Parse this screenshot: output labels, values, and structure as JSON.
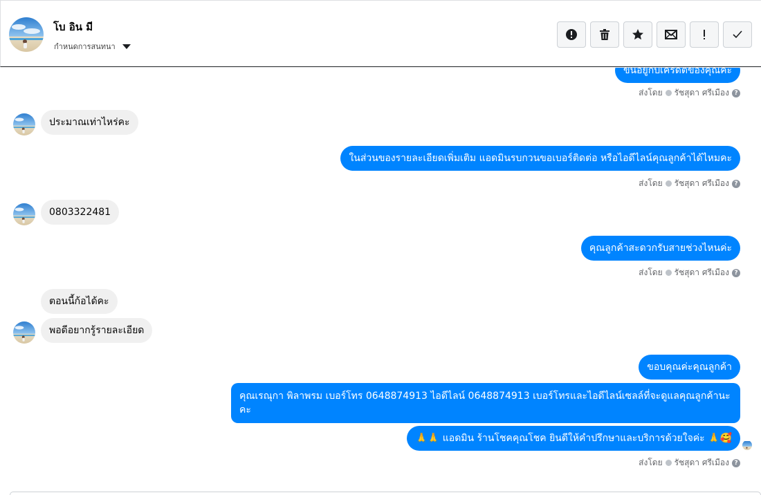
{
  "header": {
    "contact_name": "โบ อิน มี",
    "assign_label": "กำหนดการสนทนา"
  },
  "toolbar": {
    "buttons": [
      {
        "icon": "alert-circle-icon"
      },
      {
        "icon": "trash-icon"
      },
      {
        "icon": "star-icon"
      },
      {
        "icon": "envelope-icon"
      },
      {
        "icon": "exclamation-icon"
      },
      {
        "icon": "checkmark-icon"
      }
    ]
  },
  "sent_by": {
    "prefix": "ส่งโดย",
    "agent": "รัชสุดา ศรีเมือง",
    "help": "?"
  },
  "messages": {
    "m0": "ขึ้นอยู่กับเครดิตของคุณค่ะ",
    "m1": "ประมาณเท่าไหร่คะ",
    "m2": "ในส่วนของรายละเอียดเพิ่มเติม แอดมินรบกวนขอเบอร์ติดต่อ หรือไอดีไลน์คุณลูกค้าได้ไหมคะ",
    "m3": "0803322481",
    "m4": "คุณลูกค้าสะดวกรับสายช่วงไหนค่ะ",
    "m5": "ตอนนี้ก้อได้คะ",
    "m6": "พอดีอยากรู้รายละเอียด",
    "m7": "ขอบคุณค่ะคุณลูกค้า",
    "m8": "คุณเรณุกา พิลาพรม        เบอร์โทร 0648874913  ไอดีไลน์ 0648874913   เบอร์โทรและไอดีไลน์เซลล์ที่จะดูแลคุณลูกค้านะคะ",
    "m9_text": "แอดมิน ร้านโชคคุณโชค ยินดีให้คำปรึกษาและบริการด้วยใจค่ะ",
    "m9_prefix": "🙏🙏",
    "m9_suffix": "🙏🥰"
  },
  "colors": {
    "outgoing_bubble": "#0084ff",
    "incoming_bubble": "#f0f0f0",
    "meta_text": "#65676b"
  }
}
